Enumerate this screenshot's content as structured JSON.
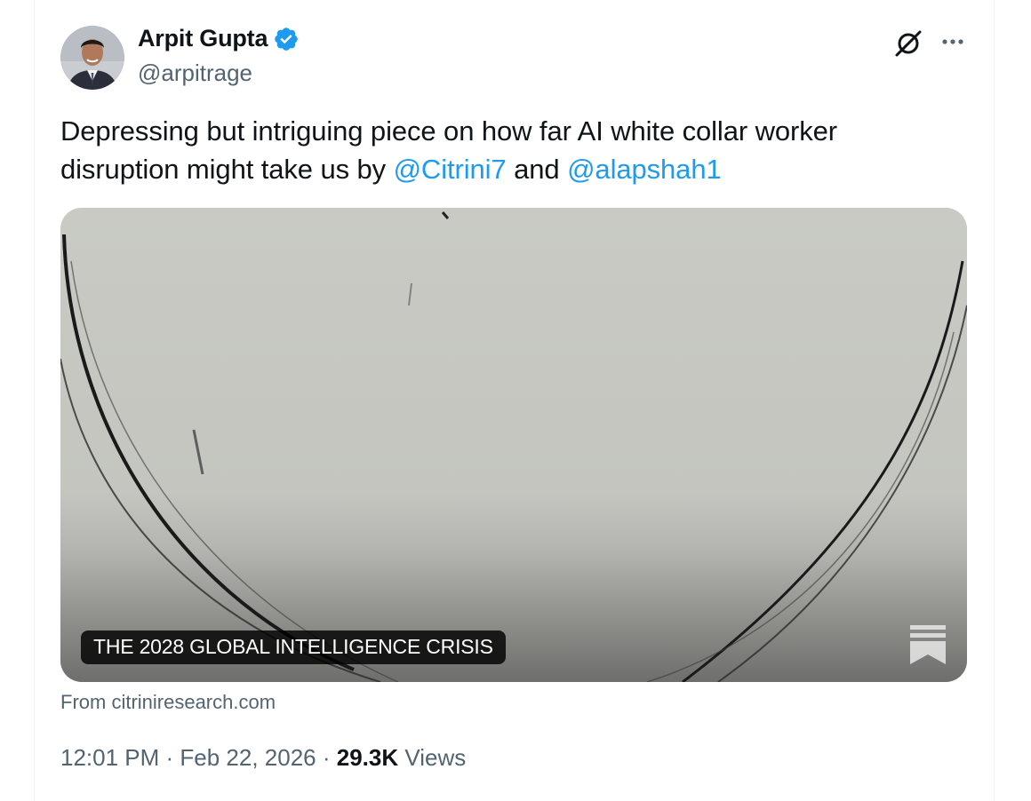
{
  "author": {
    "name": "Arpit Gupta",
    "handle": "@arpitrage",
    "verified": true
  },
  "icons": {
    "verified": "verified-badge-icon",
    "grok": "grok-icon",
    "more": "more-dots-icon",
    "bookmark": "substack-bookmark-icon"
  },
  "tweet": {
    "text_part1": "Depressing but intriguing piece on how far AI white collar worker disruption might take us by ",
    "mention1": "@Citrini7",
    "text_part2": " and ",
    "mention2": "@alapshah1"
  },
  "card": {
    "title": "THE 2028 GLOBAL INTELLIGENCE CRISIS",
    "source": "From citriniresearch.com"
  },
  "meta": {
    "time": "12:01 PM",
    "sep1": " · ",
    "date": "Feb 22, 2026",
    "sep2": " · ",
    "views_count": "29.3K",
    "views_label": " Views"
  },
  "colors": {
    "accent": "#1d9bf0",
    "secondary_text": "#536471",
    "primary_text": "#0f1419"
  }
}
